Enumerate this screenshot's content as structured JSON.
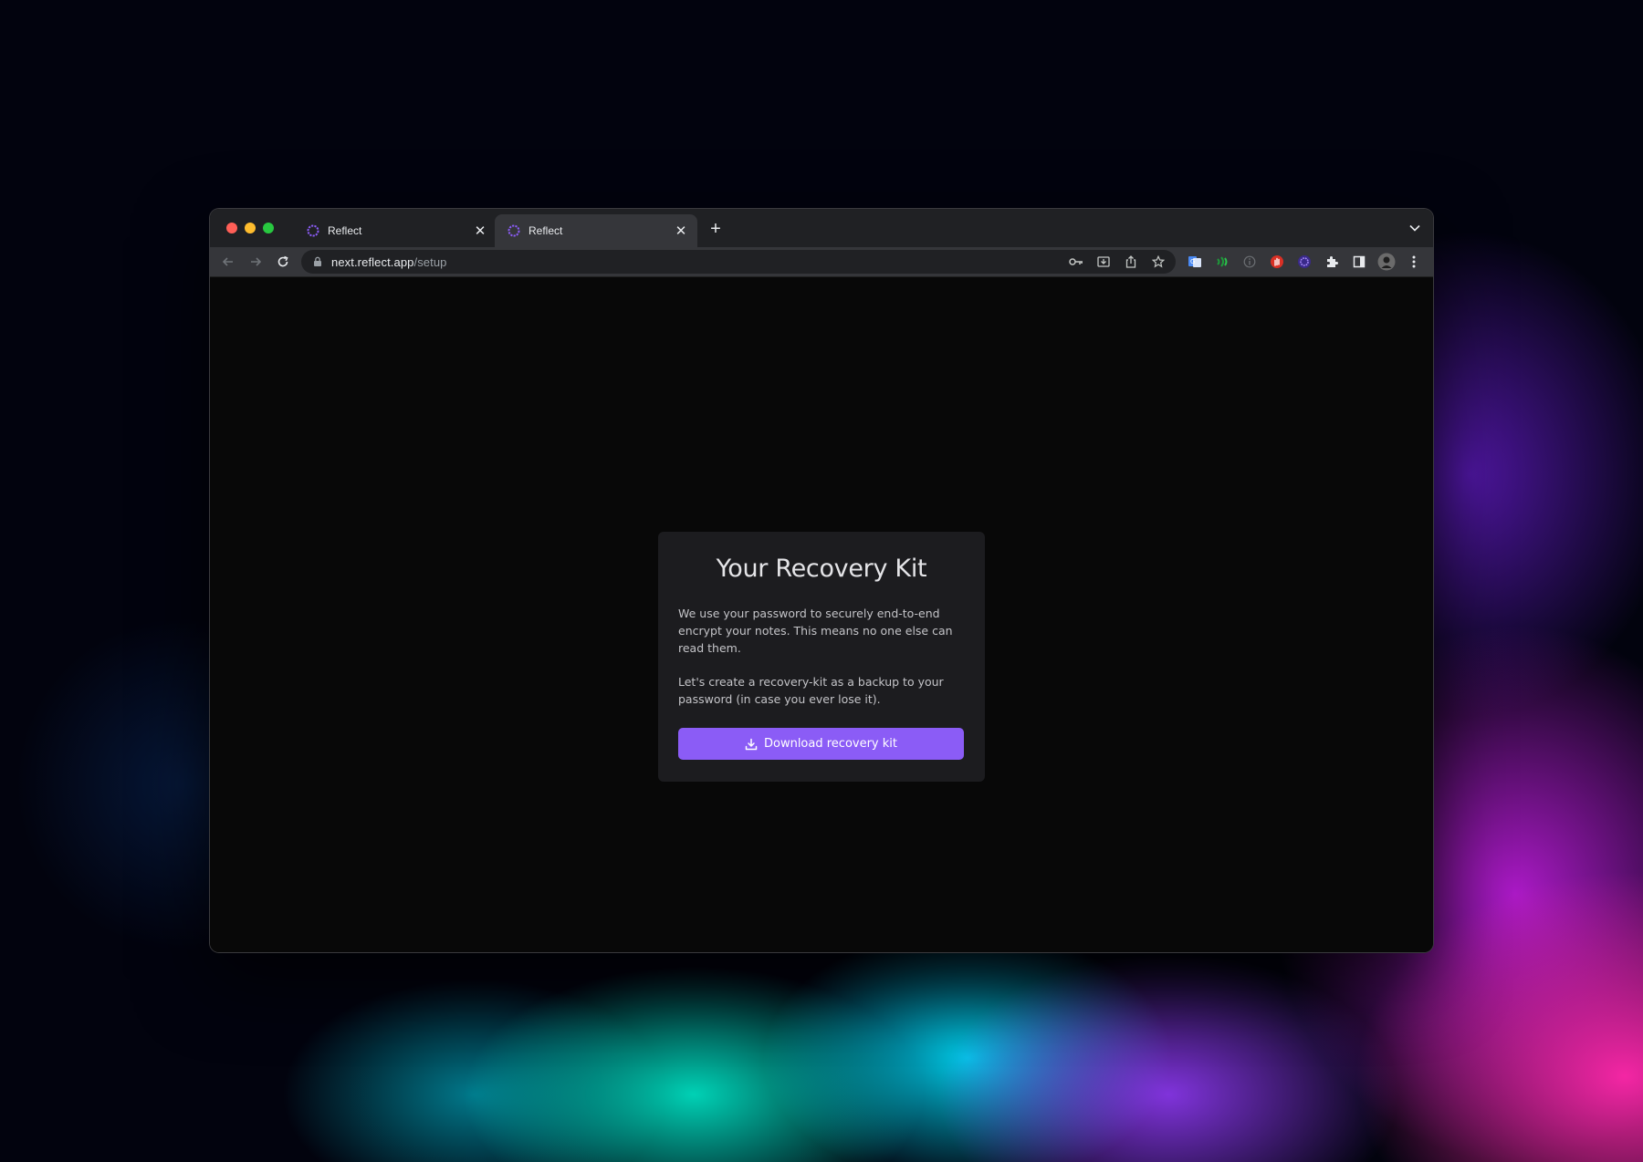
{
  "browser": {
    "tabs": [
      {
        "title": "Reflect",
        "active": false
      },
      {
        "title": "Reflect",
        "active": true
      }
    ],
    "new_tab_symbol": "+",
    "address": {
      "host": "next.reflect.app",
      "path": "/setup"
    },
    "toolbar_icons": [
      "key-icon",
      "install-icon",
      "share-icon",
      "bookmark-star-icon"
    ],
    "extension_icons": [
      "translate-extension-icon",
      "green-extension-icon",
      "info-extension-icon",
      "red-hand-extension-icon",
      "reflect-extension-icon",
      "puzzle-extensions-icon",
      "side-panel-icon",
      "profile-avatar",
      "menu-kebab-icon"
    ]
  },
  "recovery": {
    "title": "Your Recovery Kit",
    "paragraph1": "We use your password to securely end-to-end encrypt your notes. This means no one else can read them.",
    "paragraph2": "Let's create a recovery-kit as a backup to your password (in case you ever lose it).",
    "button_label": "Download recovery kit"
  },
  "colors": {
    "accent": "#8b5cf6",
    "card_bg": "#1c1c1f",
    "page_bg": "#080808",
    "tab_active": "#35363a",
    "tab_strip": "#202124"
  }
}
